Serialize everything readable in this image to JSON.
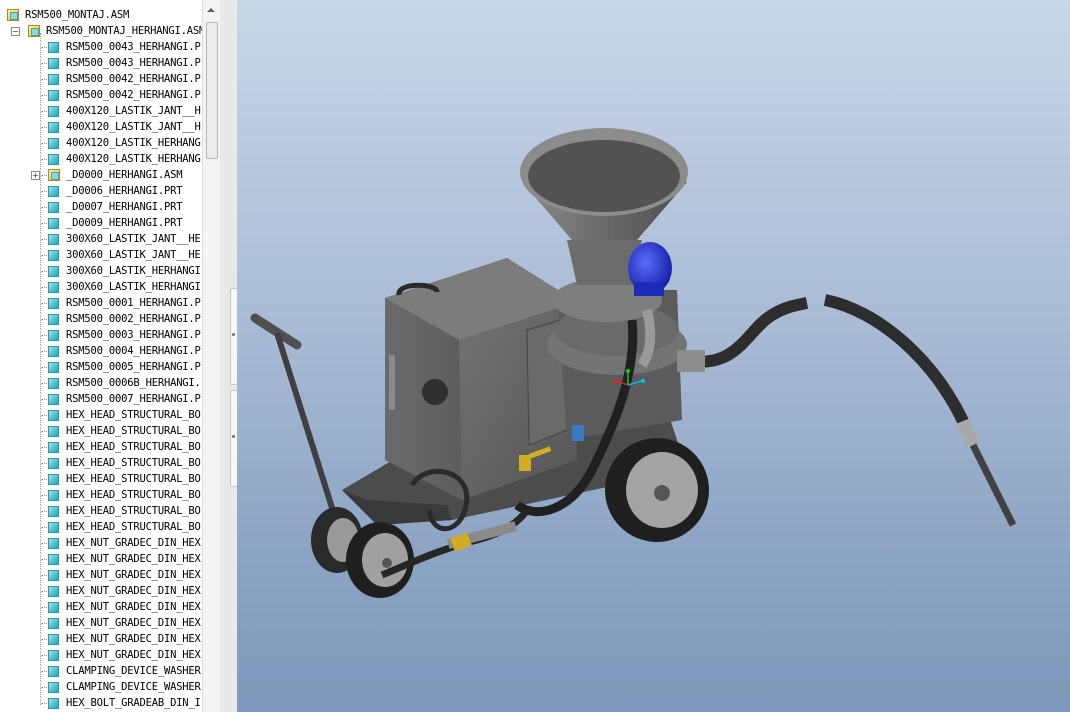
{
  "model_tree": {
    "items": [
      {
        "label": "RSM500_MONTAJ.ASM",
        "type": "asm",
        "indent": 0
      },
      {
        "label": "RSM500_MONTAJ_HERHANGI.ASM",
        "type": "asm",
        "indent": 1,
        "expander": "−"
      },
      {
        "label": "RSM500_0043_HERHANGI.P",
        "type": "part",
        "indent": 2
      },
      {
        "label": "RSM500_0043_HERHANGI.P",
        "type": "part",
        "indent": 2
      },
      {
        "label": "RSM500_0042_HERHANGI.P",
        "type": "part",
        "indent": 2
      },
      {
        "label": "RSM500_0042_HERHANGI.P",
        "type": "part",
        "indent": 2
      },
      {
        "label": "400X120_LASTIK_JANT__H",
        "type": "part",
        "indent": 2
      },
      {
        "label": "400X120_LASTIK_JANT__H",
        "type": "part",
        "indent": 2
      },
      {
        "label": "400X120_LASTIK_HERHANG",
        "type": "part",
        "indent": 2
      },
      {
        "label": "400X120_LASTIK_HERHANG",
        "type": "part",
        "indent": 2
      },
      {
        "label": "_D0000_HERHANGI.ASM",
        "type": "asm",
        "indent": 2,
        "expander": "+"
      },
      {
        "label": "_D0006_HERHANGI.PRT",
        "type": "part",
        "indent": 2
      },
      {
        "label": "_D0007_HERHANGI.PRT",
        "type": "part",
        "indent": 2
      },
      {
        "label": "_D0009_HERHANGI.PRT",
        "type": "part",
        "indent": 2
      },
      {
        "label": "300X60_LASTIK_JANT__HE",
        "type": "part",
        "indent": 2
      },
      {
        "label": "300X60_LASTIK_JANT__HE",
        "type": "part",
        "indent": 2
      },
      {
        "label": "300X60_LASTIK_HERHANGI",
        "type": "part",
        "indent": 2
      },
      {
        "label": "300X60_LASTIK_HERHANGI",
        "type": "part",
        "indent": 2
      },
      {
        "label": "RSM500_0001_HERHANGI.P",
        "type": "part",
        "indent": 2
      },
      {
        "label": "RSM500_0002_HERHANGI.P",
        "type": "part",
        "indent": 2
      },
      {
        "label": "RSM500_0003_HERHANGI.P",
        "type": "part",
        "indent": 2
      },
      {
        "label": "RSM500_0004_HERHANGI.P",
        "type": "part",
        "indent": 2
      },
      {
        "label": "RSM500_0005_HERHANGI.P",
        "type": "part",
        "indent": 2
      },
      {
        "label": "RSM500_0006B_HERHANGI.",
        "type": "part",
        "indent": 2
      },
      {
        "label": "RSM500_0007_HERHANGI.P",
        "type": "part",
        "indent": 2
      },
      {
        "label": "HEX_HEAD_STRUCTURAL_BO",
        "type": "part",
        "indent": 2
      },
      {
        "label": "HEX_HEAD_STRUCTURAL_BO",
        "type": "part",
        "indent": 2
      },
      {
        "label": "HEX_HEAD_STRUCTURAL_BO",
        "type": "part",
        "indent": 2
      },
      {
        "label": "HEX_HEAD_STRUCTURAL_BO",
        "type": "part",
        "indent": 2
      },
      {
        "label": "HEX_HEAD_STRUCTURAL_BO",
        "type": "part",
        "indent": 2
      },
      {
        "label": "HEX_HEAD_STRUCTURAL_BO",
        "type": "part",
        "indent": 2
      },
      {
        "label": "HEX_HEAD_STRUCTURAL_BO",
        "type": "part",
        "indent": 2
      },
      {
        "label": "HEX_HEAD_STRUCTURAL_BO",
        "type": "part",
        "indent": 2
      },
      {
        "label": "HEX_NUT_GRADEC_DIN_HEX",
        "type": "part",
        "indent": 2
      },
      {
        "label": "HEX_NUT_GRADEC_DIN_HEX",
        "type": "part",
        "indent": 2
      },
      {
        "label": "HEX_NUT_GRADEC_DIN_HEX",
        "type": "part",
        "indent": 2
      },
      {
        "label": "HEX_NUT_GRADEC_DIN_HEX",
        "type": "part",
        "indent": 2
      },
      {
        "label": "HEX_NUT_GRADEC_DIN_HEX",
        "type": "part",
        "indent": 2
      },
      {
        "label": "HEX_NUT_GRADEC_DIN_HEX",
        "type": "part",
        "indent": 2
      },
      {
        "label": "HEX_NUT_GRADEC_DIN_HEX",
        "type": "part",
        "indent": 2
      },
      {
        "label": "HEX_NUT_GRADEC_DIN_HEX",
        "type": "part",
        "indent": 2
      },
      {
        "label": "CLAMPING_DEVICE_WASHER",
        "type": "part",
        "indent": 2
      },
      {
        "label": "CLAMPING_DEVICE_WASHER",
        "type": "part",
        "indent": 2
      },
      {
        "label": "HEX_BOLT_GRADEAB_DIN_I",
        "type": "part",
        "indent": 2
      }
    ]
  },
  "scrollbar": {
    "up_icon": "triangle-up-icon"
  },
  "colors": {
    "viewport_top": "#c9d6e8",
    "viewport_bottom": "#7f98bb",
    "machine_body": "#5a5a5a",
    "motor": "#1f2fd0",
    "valve": "#d8b020",
    "hose": "#222222"
  }
}
